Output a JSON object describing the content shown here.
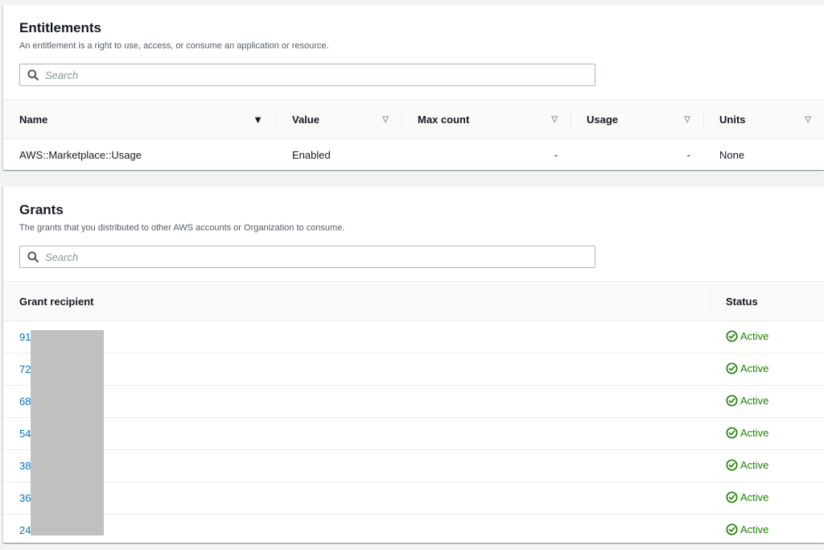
{
  "entitlements": {
    "title": "Entitlements",
    "description": "An entitlement is a right to use, access, or consume an application or resource.",
    "search_placeholder": "Search",
    "columns": [
      "Name",
      "Value",
      "Max count",
      "Usage",
      "Units"
    ],
    "rows": [
      {
        "name": "AWS::Marketplace::Usage",
        "value": "Enabled",
        "max_count": "-",
        "usage": "-",
        "units": "None"
      }
    ]
  },
  "grants": {
    "title": "Grants",
    "description": "The grants that you distributed to other AWS accounts or Organization to consume.",
    "search_placeholder": "Search",
    "columns": [
      "Grant recipient",
      "Status"
    ],
    "rows": [
      {
        "recipient": "91",
        "status": "Active"
      },
      {
        "recipient": "72",
        "status": "Active"
      },
      {
        "recipient": "68",
        "status": "Active"
      },
      {
        "recipient": "54",
        "status": "Active"
      },
      {
        "recipient": "38",
        "status": "Active"
      },
      {
        "recipient": "36",
        "status": "Active"
      },
      {
        "recipient": "24",
        "status": "Active"
      }
    ]
  },
  "icons": {
    "search": "search-icon",
    "sort_active": "sort-descending-icon",
    "sort_inactive": "sort-caret-icon",
    "status": "status-check-circle-icon"
  },
  "colors": {
    "link": "#0073bb",
    "success": "#1d8102",
    "redaction": "#c0c0c0"
  }
}
